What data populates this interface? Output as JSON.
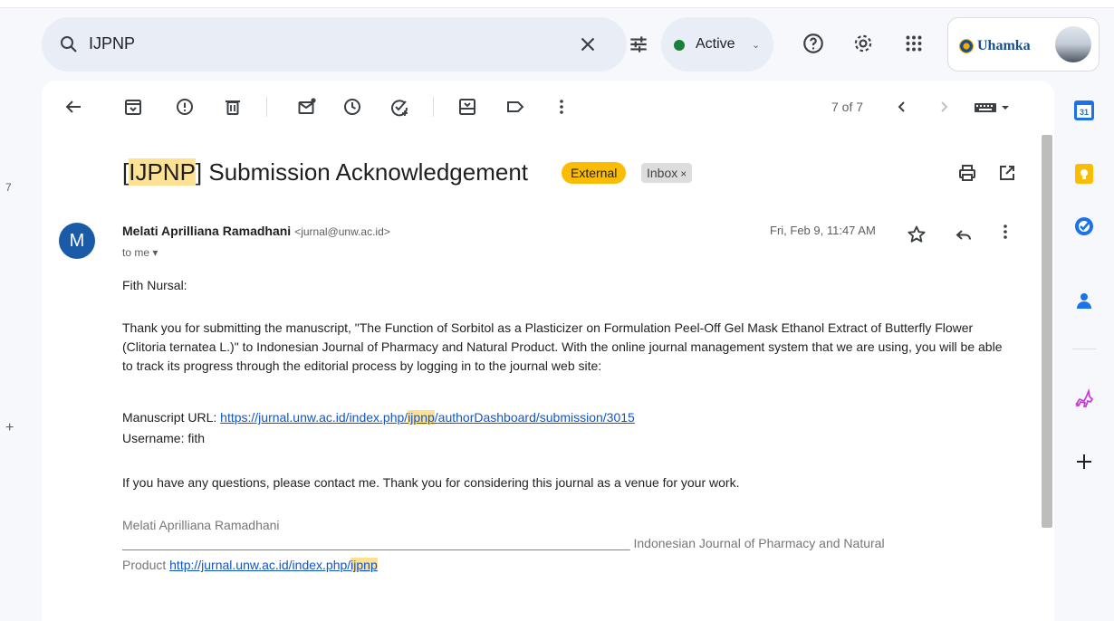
{
  "search": {
    "query": "IJPNP",
    "status_label": "Active"
  },
  "account": {
    "logo_text": "Uhamka"
  },
  "toolbar": {
    "pager_text": "7 of 7"
  },
  "email": {
    "subject_prefix": "[",
    "subject_highlight": "IJPNP",
    "subject_rest": "] Submission Acknowledgement",
    "label_external": "External",
    "label_inbox": "Inbox",
    "label_inbox_remove": "×",
    "sender_initial": "M",
    "sender_name": "Melati Aprilliana Ramadhani",
    "sender_email": "<jurnal@unw.ac.id>",
    "recipient": "to me",
    "date": "Fri, Feb 9, 11:47 AM",
    "greeting": "Fith Nursal:",
    "paragraph1": "Thank you for submitting the manuscript, \"The Function of Sorbitol as a Plasticizer on Formulation Peel-Off Gel Mask Ethanol Extract of Butterfly Flower (Clitoria ternatea L.)\" to Indonesian Journal of Pharmacy and Natural Product. With the online journal management system that we are using, you will be able to track its progress through the editorial process by logging in to the journal web site:",
    "manuscript_url_label": "Manuscript URL: ",
    "manuscript_url_part1": "https://jurnal.unw.ac.id/index.php/",
    "manuscript_url_highlight": "ijpnp",
    "manuscript_url_part2": "/authorDashboard/submission/3015",
    "username_line": "Username: fith",
    "paragraph2": "If you have any questions, please contact me. Thank you for considering this journal as a venue for your work.",
    "signature_name": "Melati Aprilliana Ramadhani",
    "signature_rule": "________________________________________________________________________",
    "signature_journal": "Indonesian Journal of Pharmacy and Natural",
    "signature_product": "Product ",
    "signature_url_part1": "http://jurnal.unw.ac.id/index.php/",
    "signature_url_highlight": "ijpnp"
  },
  "left_edge": {
    "number": "7",
    "symbol": "+"
  },
  "rail": {
    "calendar_day": "31"
  },
  "colors": {
    "accent_blue": "#1a73e8",
    "active_green": "#188038",
    "external_yellow": "#fbbc04",
    "highlight": "#fde293"
  }
}
